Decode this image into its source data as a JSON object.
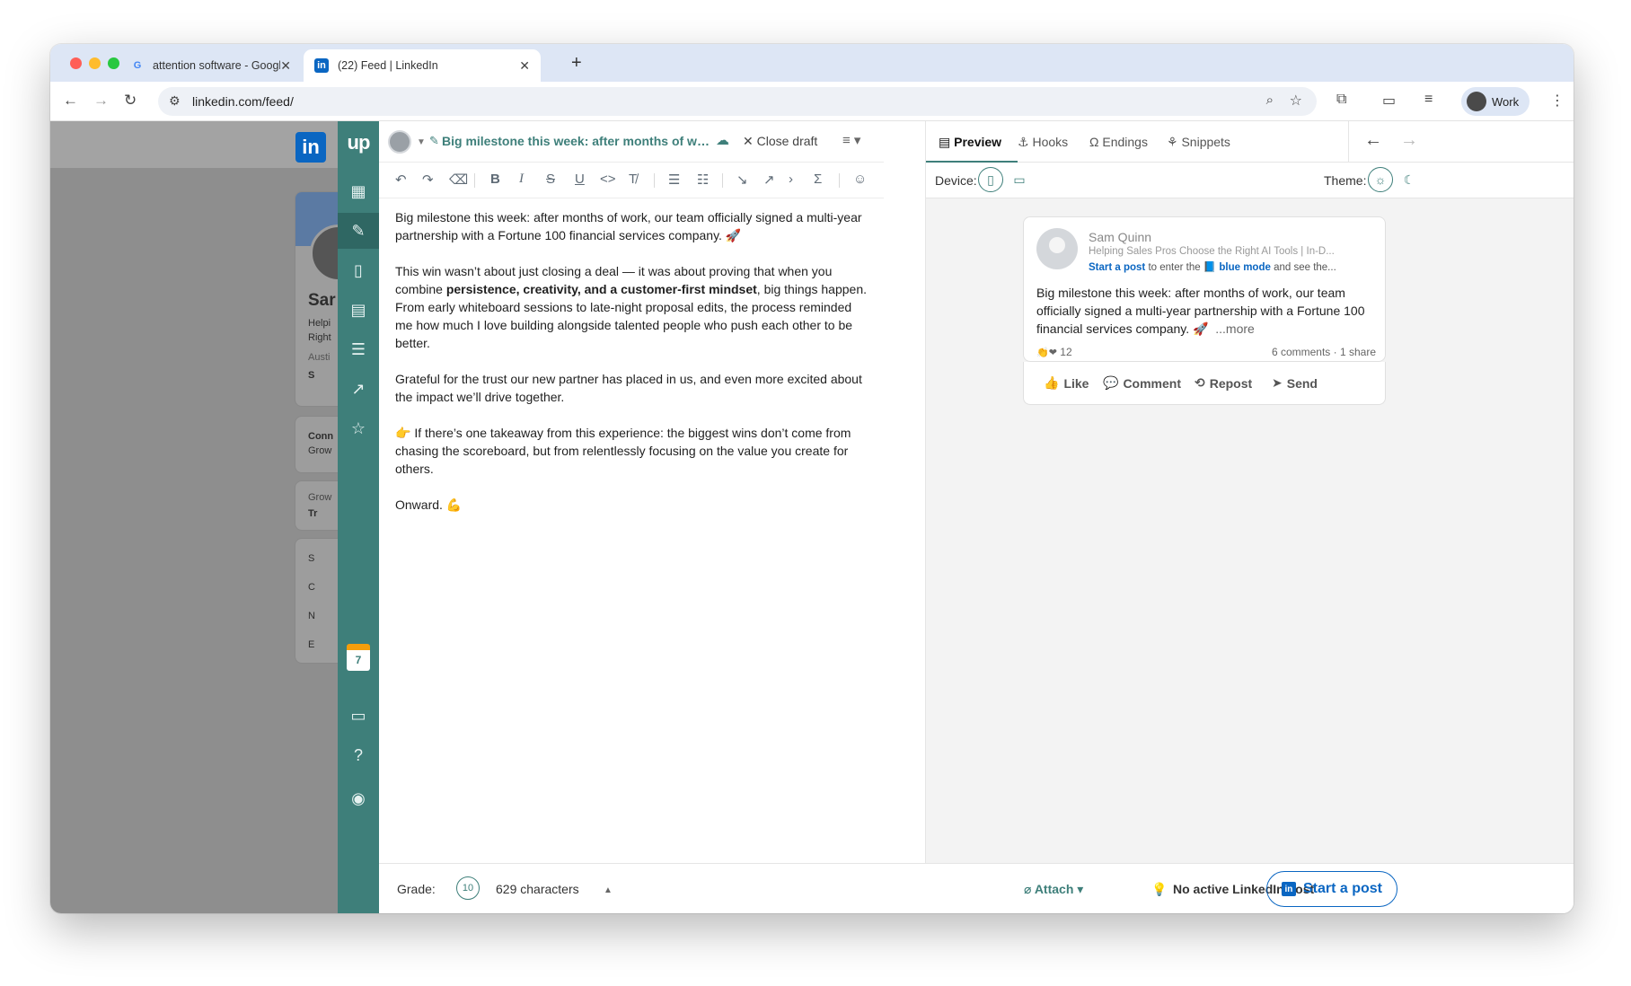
{
  "browser": {
    "tabs": [
      {
        "title": "attention software - Google S",
        "favicon": "google-icon"
      },
      {
        "title": "(22) Feed | LinkedIn",
        "favicon": "linkedin-icon"
      }
    ],
    "url": "linkedin.com/feed/",
    "profile_label": "Work"
  },
  "linkedin_bg": {
    "logo": "in",
    "profile_name": "Sar",
    "headline_1": "Helpi",
    "headline_2": "Right",
    "location": "Austi",
    "s_item": "S",
    "conn_label": "Conn",
    "conn_sub": "Grow",
    "grow_label": "Grow",
    "grow_item": "Tr",
    "menu_1": "S",
    "menu_2": "C",
    "menu_3": "N",
    "menu_4": "E"
  },
  "rail": {
    "logo": "up",
    "calendar_day": "7"
  },
  "editor": {
    "draft_title": "Big milestone this week: after months of wo...",
    "close_draft": "Close draft",
    "paragraphs": {
      "p1": "Big milestone this week: after months of work, our team officially signed a multi-year partnership with a Fortune 100 financial services company. 🚀",
      "p2_a": "This win wasn’t about just closing a deal — it was about proving that when you combine ",
      "p2_bold": "persistence, creativity, and a customer-first mindset",
      "p2_b": ", big things happen. From early whiteboard sessions to late-night proposal edits, the process reminded me how much I love building alongside talented people who push each other to be better.",
      "p3": "Grateful for the trust our new partner has placed in us, and even more excited about the impact we’ll drive together.",
      "p4": "👉 If there’s one takeaway from this experience: the biggest wins don’t come from chasing the scoreboard, but from relentlessly focusing on the value you create for others.",
      "p5": "Onward. 💪"
    }
  },
  "preview": {
    "tabs": [
      "Preview",
      "Hooks",
      "Endings",
      "Snippets"
    ],
    "device_label": "Device:",
    "theme_label": "Theme:",
    "post": {
      "name": "Sam Quinn",
      "headline": "Helping Sales Pros Choose the Right AI Tools | In-D...",
      "cta_link": "Start a post",
      "cta_mid": " to enter the 📘 ",
      "cta_mode": "blue mode",
      "cta_end": " and see the...",
      "text": "Big milestone this week: after months of work, our team officially signed a multi-year partnership with a Fortune 100 financial services company. 🚀",
      "more": "...more",
      "reactions": "12",
      "stats": "6 comments · 1 share",
      "actions": [
        "Like",
        "Comment",
        "Repost",
        "Send"
      ]
    }
  },
  "footer": {
    "grade_label": "Grade:",
    "grade_value": "10",
    "characters": "629 characters",
    "attach": "Attach",
    "no_active": "No active LinkedIn post",
    "start_post": "Start a post"
  },
  "colors": {
    "accent": "#3e7f7a",
    "linkedin_blue": "#0a66c2"
  }
}
